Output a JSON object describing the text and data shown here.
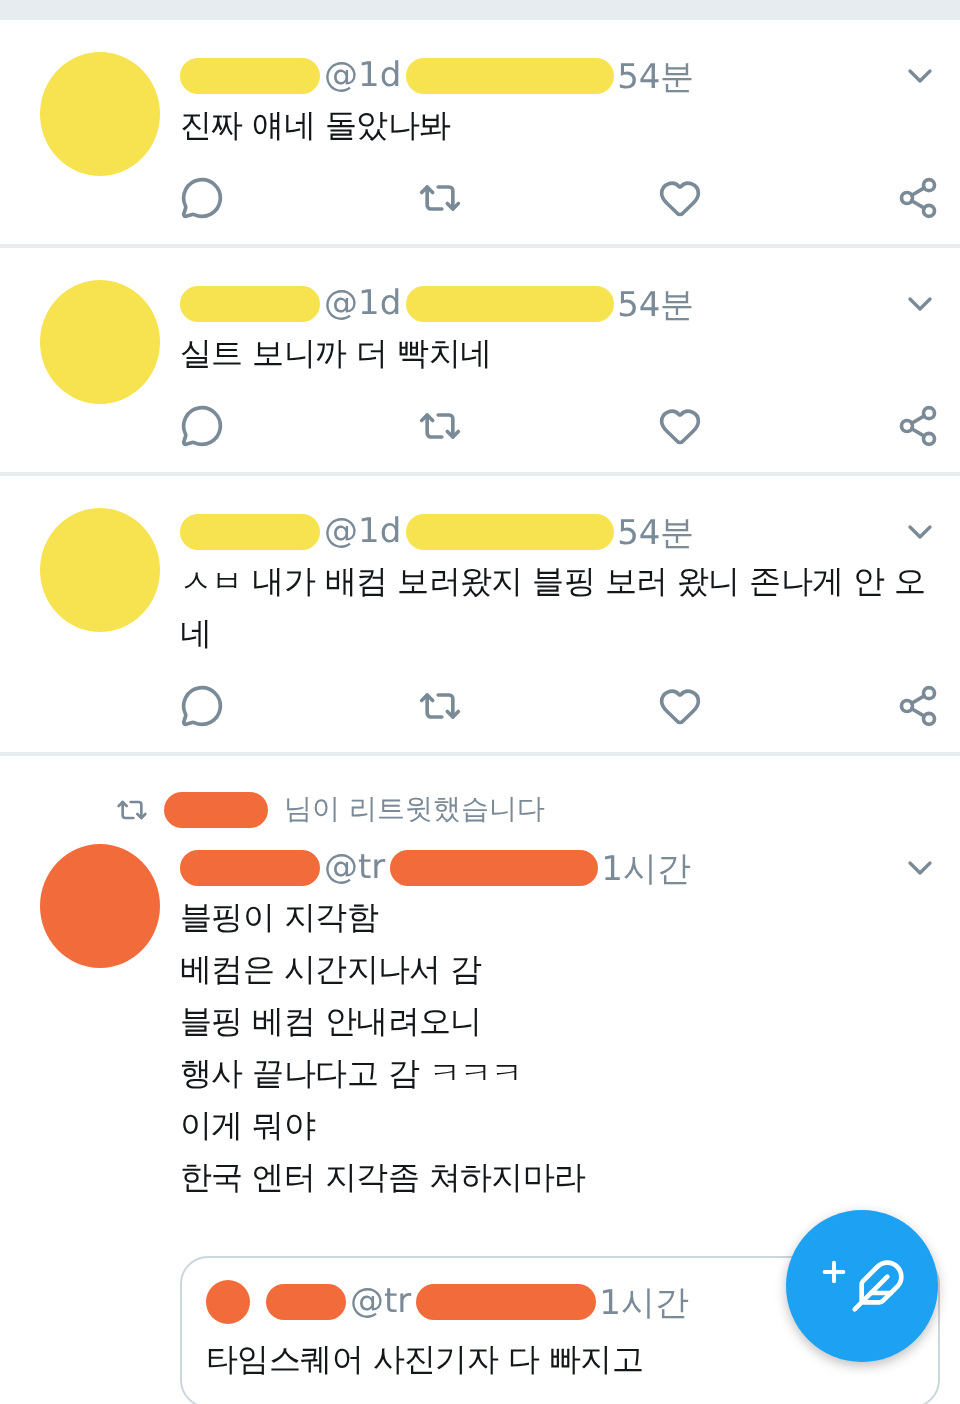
{
  "tweets": [
    {
      "kind": "tweet",
      "color": "#f7e34f",
      "handle": "@1d",
      "time": "54분",
      "lines": [
        "진짜 얘네 돌았나봐"
      ]
    },
    {
      "kind": "tweet",
      "color": "#f7e34f",
      "handle": "@1d",
      "time": "54분",
      "lines": [
        "실트 보니까 더 빡치네"
      ]
    },
    {
      "kind": "tweet",
      "color": "#f7e34f",
      "handle": "@1d",
      "time": "54분",
      "lines": [
        "ㅅㅂ 내가 배컴 보러왔지 블핑 보러 왔니 존나게 안 오네"
      ]
    },
    {
      "kind": "retweet",
      "color": "#f26b3a",
      "retweeted_by": "님이 리트윗했습니다",
      "handle": "@tr",
      "time": "1시간",
      "lines": [
        "블핑이 지각함",
        "베컴은 시간지나서 감",
        "블핑 베컴 안내려오니",
        "행사 끝나다고 감 ㅋㅋㅋ",
        "이게 뭐야",
        "한국 엔터 지각좀 쳐하지마라"
      ],
      "quote": {
        "handle": "@tr",
        "time": "1시간",
        "lines": [
          "타임스퀘어 사진기자 다 빠지고"
        ]
      }
    }
  ]
}
